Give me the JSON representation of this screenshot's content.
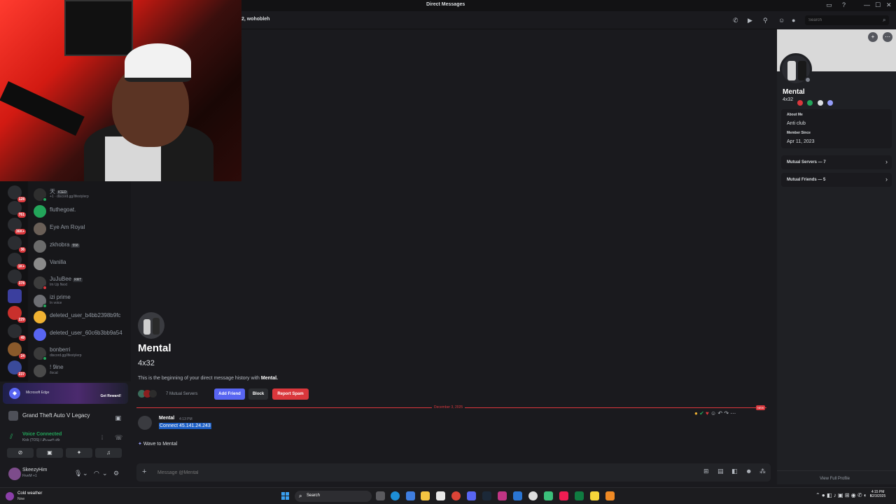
{
  "window": {
    "title": "Direct Messages",
    "controls": [
      "—",
      "☐",
      "✕"
    ]
  },
  "chat_header": {
    "name": "2, wohobleh",
    "search_placeholder": "Search"
  },
  "servers": [
    {
      "badge": "128"
    },
    {
      "badge": "761"
    },
    {
      "badge": "36K+"
    },
    {
      "badge": "36"
    },
    {
      "badge": "1K+"
    },
    {
      "badge": "378"
    },
    {
      "badge": ""
    },
    {
      "badge": "229"
    },
    {
      "badge": "49"
    },
    {
      "badge": "24"
    },
    {
      "badge": "237"
    }
  ],
  "dm_list": [
    {
      "name": "天",
      "tag": "ICED",
      "sub": "+1 · discord.gg/lifestylerp"
    },
    {
      "name": "fluthegoat.",
      "sub": ""
    },
    {
      "name": "Eye Am Royal",
      "sub": ""
    },
    {
      "name": "zkhobra",
      "tag": "558",
      "sub": ""
    },
    {
      "name": "Vanilla",
      "sub": ""
    },
    {
      "name": "JuJuBee",
      "tag": "RRT",
      "sub": "Im Up Next"
    },
    {
      "name": "izi prime",
      "sub": "In voice"
    },
    {
      "name": "deleted_user_b4bb2398b9fc",
      "sub": ""
    },
    {
      "name": "deleted_user_60c6b3bb9a54",
      "sub": ""
    },
    {
      "name": "bonberri",
      "sub": "discord.gg/lifestylerp"
    },
    {
      "name": "! 9ine",
      "sub": "/local"
    }
  ],
  "promo": {
    "text": "Microsoft Edge",
    "button": "Get Reward!"
  },
  "game": {
    "name": "Grand Theft Auto V Legacy"
  },
  "voice": {
    "title": "Voice Connected",
    "subtitle": "Kick (TOS) / 𝒫𝓇𝒾𝓂𝑒𝒱𝒾𝓁𝓁𝑒"
  },
  "user": {
    "name": "SkeezyHim",
    "status": "FiveM +1"
  },
  "intro": {
    "name": "Mental",
    "username": "4x32",
    "description_prefix": "This is the beginning of your direct message history with ",
    "description_name": "Mental.",
    "mutual_servers": "7 Mutual Servers",
    "add_friend": "Add Friend",
    "block": "Block",
    "report_spam": "Report Spam"
  },
  "divider": {
    "date": "December 3, 2025",
    "new_label": "NEW"
  },
  "message": {
    "author": "Mental",
    "time": "4:13 PM",
    "text": "Connect 45.141.24.243"
  },
  "wave": {
    "label": "Wave to Mental"
  },
  "composer": {
    "placeholder": "Message @Mental"
  },
  "profile": {
    "name": "Mental",
    "username": "4x32",
    "about_label": "About Me",
    "about_value": "Anti club",
    "member_since_label": "Member Since",
    "member_since_value": "Apr 11, 2023",
    "mutual_servers": "Mutual Servers — 7",
    "mutual_friends": "Mutual Friends — 5",
    "view_full": "View Full Profile"
  },
  "taskbar": {
    "weather_title": "Cold weather",
    "weather_sub": "Now",
    "search": "Search",
    "time": "4:15 PM",
    "date": "12/3/2025"
  },
  "colors": {
    "accent": "#5865f2",
    "danger": "#da373c",
    "online": "#23a55a",
    "selection": "#1d5fc4"
  }
}
